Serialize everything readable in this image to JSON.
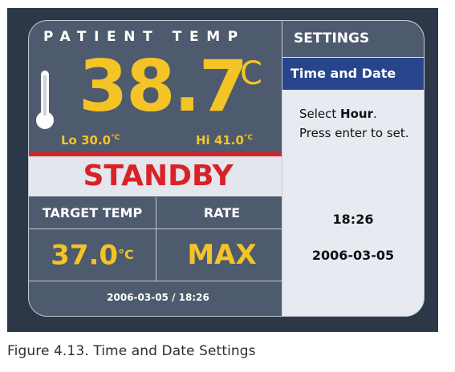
{
  "device": {
    "title": "PATIENT TEMP",
    "patient_temp": "38.7",
    "temp_unit": "°C",
    "lo_label": "Lo",
    "lo_value": "30.0",
    "hi_label": "Hi",
    "hi_value": "41.0",
    "small_unit": "°C",
    "status": "STANDBY",
    "target_label": "TARGET TEMP",
    "target_value": "37.0",
    "rate_label": "RATE",
    "rate_value": "MAX",
    "footer_datetime": "2006-03-05 / 18:26"
  },
  "settings": {
    "title": "SETTINGS",
    "selected_item": "Time and Date",
    "instruction_prefix": "Select ",
    "instruction_field": "Hour",
    "instruction_suffix": ".",
    "instruction_line2": "Press enter to set.",
    "time": "18:26",
    "date": "2006-03-05"
  },
  "caption": "Figure 4.13. Time and Date Settings",
  "colors": {
    "background": "#2c3748",
    "panel": "#4e5a6d",
    "accent_yellow": "#f4c427",
    "alert_red": "#d72328",
    "highlight_blue": "#27458d"
  },
  "icons": {
    "thermometer": "thermometer-icon"
  }
}
